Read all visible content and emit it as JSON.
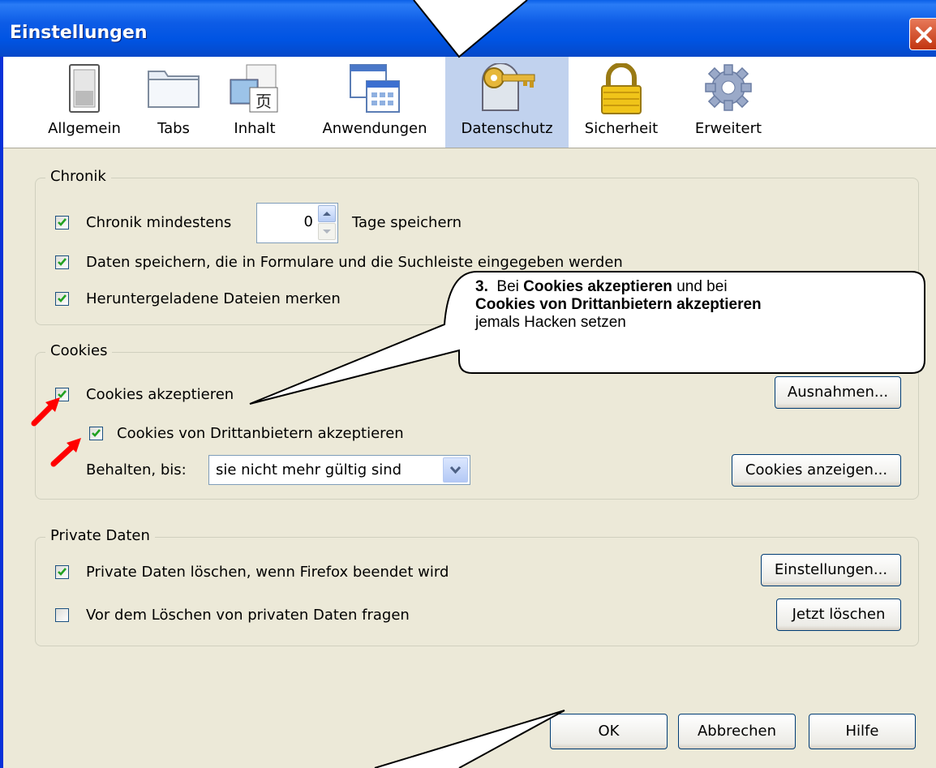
{
  "window": {
    "title": "Einstellungen"
  },
  "toolbar": {
    "items": [
      {
        "label": "Allgemein",
        "icon": "switch-icon"
      },
      {
        "label": "Tabs",
        "icon": "folder-tabs-icon"
      },
      {
        "label": "Inhalt",
        "icon": "content-icon"
      },
      {
        "label": "Anwendungen",
        "icon": "applications-icon"
      },
      {
        "label": "Datenschutz",
        "icon": "privacy-key-icon",
        "selected": true
      },
      {
        "label": "Sicherheit",
        "icon": "padlock-icon"
      },
      {
        "label": "Erweitert",
        "icon": "gear-icon"
      }
    ]
  },
  "chronik": {
    "legend": "Chronik",
    "keep_history": {
      "checked": true,
      "before": "Chronik mindestens",
      "after": "Tage speichern",
      "days": "0"
    },
    "form_data": {
      "checked": true,
      "label": "Daten speichern, die in Formulare und die Suchleiste eingegeben werden"
    },
    "downloads": {
      "checked": true,
      "label": "Heruntergeladene Dateien merken"
    }
  },
  "cookies": {
    "legend": "Cookies",
    "accept": {
      "checked": true,
      "label": "Cookies akzeptieren"
    },
    "third_party": {
      "checked": true,
      "label": "Cookies von Drittanbietern akzeptieren"
    },
    "keep_until_label": "Behalten, bis:",
    "keep_until_value": "sie nicht mehr gültig sind",
    "exceptions_button": "Ausnahmen...",
    "show_cookies_button": "Cookies anzeigen..."
  },
  "private_data": {
    "legend": "Private Daten",
    "clear_on_exit": {
      "checked": true,
      "label": "Private Daten löschen, wenn Firefox beendet wird"
    },
    "ask_before": {
      "checked": false,
      "label": "Vor dem Löschen von privaten Daten fragen"
    },
    "settings_button": "Einstellungen...",
    "clear_now_button": "Jetzt löschen"
  },
  "footer": {
    "ok": "OK",
    "cancel": "Abbrechen",
    "help": "Hilfe"
  },
  "callout": {
    "step": "3.",
    "t1": "Bei",
    "b1": "Cookies akzeptieren",
    "t2": "und bei",
    "b2": "Cookies von Drittanbietern akzeptieren",
    "t3": "jemals Hacken setzen"
  },
  "colors": {
    "title_bar": "#0054e3",
    "dialog_bg": "#ece9d8",
    "selected_tab": "#c1d2ee",
    "checkmark": "#21a121",
    "arrow": "#ff0000"
  }
}
